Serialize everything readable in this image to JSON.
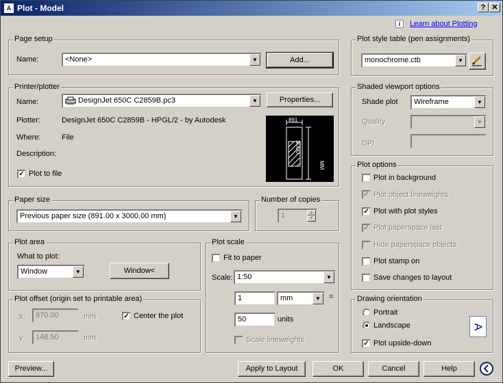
{
  "window": {
    "title": "Plot - Model",
    "help_btn": "?",
    "close_btn": "✕"
  },
  "info": {
    "icon": "i",
    "link": "Learn about Plotting"
  },
  "page_setup": {
    "label": "Page setup",
    "name_label": "Name:",
    "name_value": "<None>",
    "add_button": "Add..."
  },
  "printer": {
    "label": "Printer/plotter",
    "name_label": "Name:",
    "name_value": "DesignJet 650C C2859B.pc3",
    "properties_button": "Properties...",
    "plotter_label": "Plotter:",
    "plotter_value": "DesignJet 650C C2859B - HPGL/2 - by Autodesk",
    "where_label": "Where:",
    "where_value": "File",
    "description_label": "Description:",
    "plot_to_file_label": "Plot to file",
    "preview_width_label": "891",
    "preview_height_label": "3000",
    "preview_units": "MM"
  },
  "paper_size": {
    "label": "Paper size",
    "value": "Previous paper size  (891.00 x 3000.00 mm)"
  },
  "copies": {
    "label": "Number of copies",
    "value": "1"
  },
  "plot_area": {
    "label": "Plot area",
    "what_label": "What to plot:",
    "what_value": "Window",
    "window_button": "Window<"
  },
  "plot_offset": {
    "label": "Plot offset (origin set to printable area)",
    "x_label": "X:",
    "x_value": "870.00",
    "x_units": "mm",
    "y_label": "Y:",
    "y_value": "148.50",
    "y_units": "mm",
    "center_label": "Center the plot"
  },
  "plot_scale": {
    "label": "Plot scale",
    "fit_label": "Fit to paper",
    "scale_label": "Scale:",
    "scale_value": "1:50",
    "value1": "1",
    "unit1": "mm",
    "equals": "=",
    "value2": "50",
    "unit2": "units",
    "lineweights_label": "Scale lineweights"
  },
  "plot_style": {
    "label": "Plot style table (pen assignments)",
    "value": "monochrome.ctb"
  },
  "shaded": {
    "label": "Shaded viewport options",
    "shade_label": "Shade plot",
    "shade_value": "Wireframe",
    "quality_label": "Quality",
    "dpi_label": "DPI"
  },
  "plot_options": {
    "label": "Plot options",
    "items": [
      {
        "label": "Plot in background",
        "checked": false,
        "disabled": false
      },
      {
        "label": "Plot object lineweights",
        "checked": true,
        "disabled": true
      },
      {
        "label": "Plot with plot styles",
        "checked": true,
        "disabled": false
      },
      {
        "label": "Plot paperspace last",
        "checked": true,
        "disabled": true
      },
      {
        "label": "Hide paperspace objects",
        "checked": false,
        "disabled": true
      },
      {
        "label": "Plot stamp on",
        "checked": false,
        "disabled": false
      },
      {
        "label": "Save changes to layout",
        "checked": false,
        "disabled": false
      }
    ]
  },
  "orientation": {
    "label": "Drawing orientation",
    "portrait": "Portrait",
    "landscape": "Landscape",
    "upside_down": "Plot upside-down",
    "icon_letter": "A"
  },
  "footer": {
    "preview": "Preview...",
    "apply": "Apply to Layout",
    "ok": "OK",
    "cancel": "Cancel",
    "help": "Help"
  }
}
